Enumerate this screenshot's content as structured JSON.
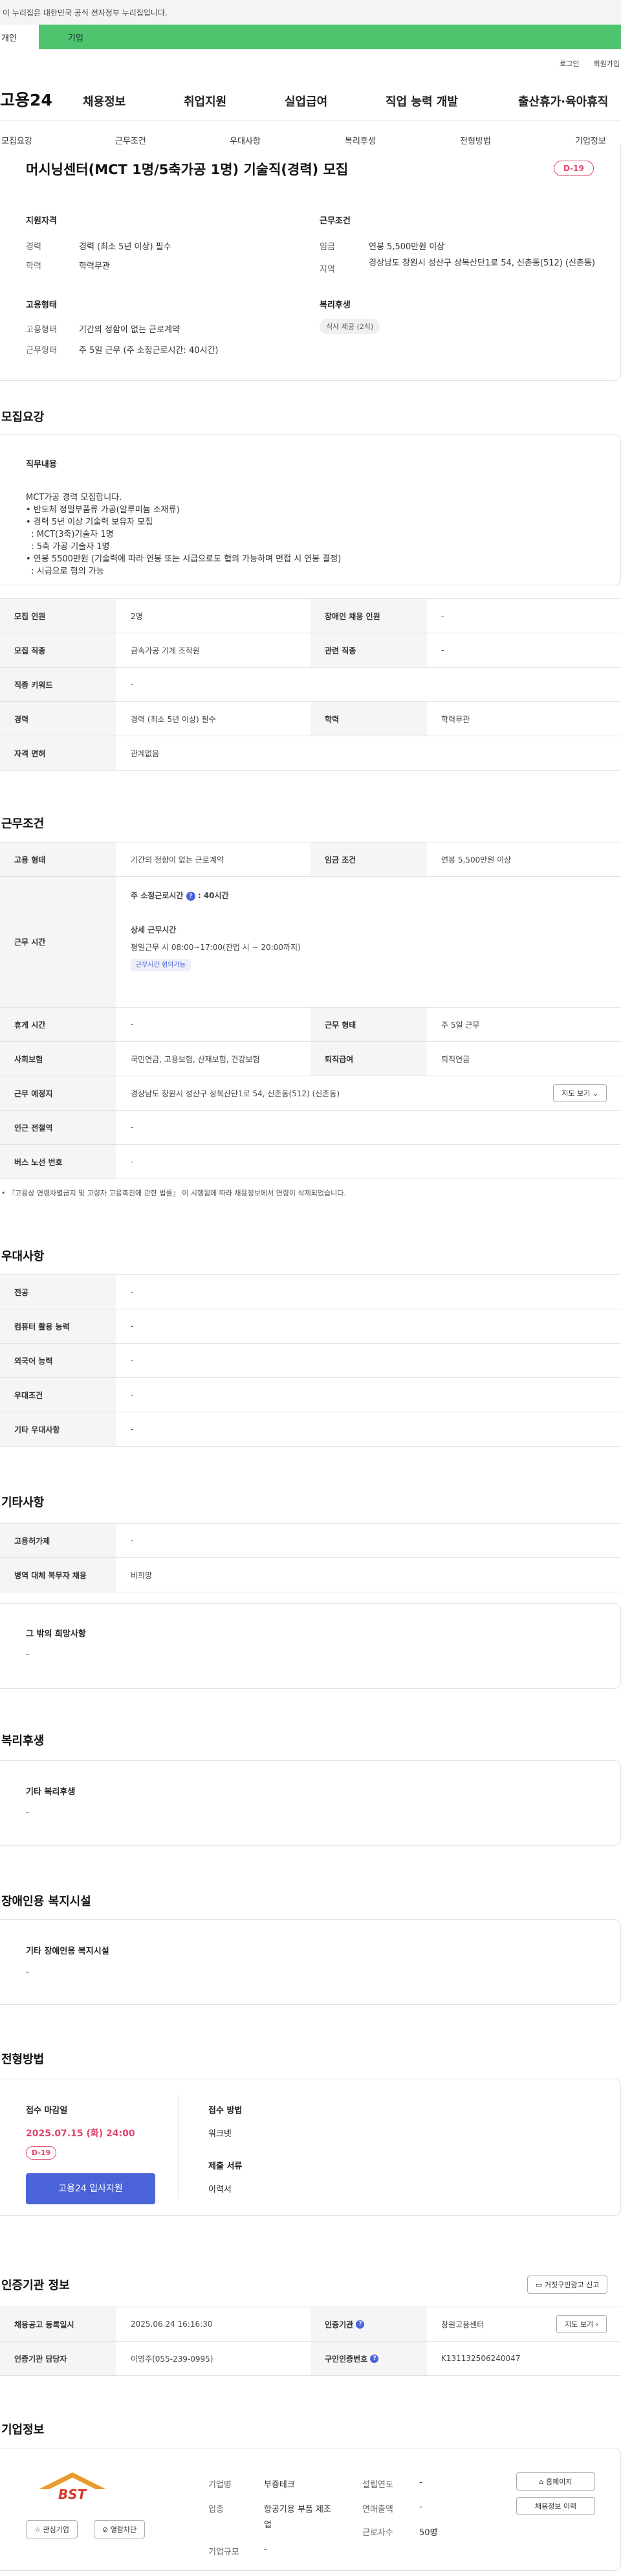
{
  "gov_banner": "이 누리집은 대한민국 공식 전자정부 누리집입니다.",
  "top_tabs": {
    "personal": "개인",
    "corp": "기업"
  },
  "util": {
    "login": "로그인",
    "signup": "회원가입"
  },
  "logo": "고용24",
  "gnb": [
    "채용정보",
    "취업지원",
    "실업급여",
    "직업 능력 개발",
    "출산휴가·육아휴직"
  ],
  "subnav": [
    "모집요강",
    "근무조건",
    "우대사항",
    "복리후생",
    "전형방법",
    "기업정보"
  ],
  "job": {
    "title": "머시닝센터(MCT 1명/5축가공 1명) 기술직(경력) 모집",
    "dday": "D-19",
    "qual_head": "지원자격",
    "career_lbl": "경력",
    "career_val": "경력 (최소 5년 이상) 필수",
    "edu_lbl": "학력",
    "edu_val": "학력무관",
    "emp_head": "고용형태",
    "emptype_lbl": "고용형태",
    "emptype_val": "기간의 정함이 없는 근로계약",
    "worktype_lbl": "근무형태",
    "worktype_val": "주 5일 근무 (주 소정근로시간: 40시간)",
    "cond_head": "근무조건",
    "wage_lbl": "임금",
    "wage_val": "연봉 5,500만원 이상",
    "area_lbl": "지역",
    "area_val": "경상남도 창원시 성산구 상복산단1로 54, 신촌동(512) (신촌동)",
    "welfare_head": "복리후생",
    "welfare_chip": "식사 제공 (2식)"
  },
  "recruit": {
    "section": "모집요강",
    "duty_head": "직무내용",
    "duty_lines": [
      "MCT가공 경력 모집합니다.",
      "• 반도체 정밀부품류 가공(알루미늄 소재류)",
      "• 경력 5년 이상 기술력 보유자 모집",
      "  : MCT(3축)기술자 1명",
      "  : 5축 가공 기술자 1명",
      "• 연봉 5500만원 (기술력에 따라 연봉 또는 시급으로도 협의 가능하며 면접 시 연봉 결정)",
      "  : 시급으로 협의 가능"
    ],
    "rows": [
      {
        "l1": "모집 인원",
        "v1": "2명",
        "l2": "장애인 채용 인원",
        "v2": "-"
      },
      {
        "l1": "모집 직종",
        "v1": "금속가공 기계 조작원",
        "l2": "관련 직종",
        "v2": "-"
      },
      {
        "l1": "직종 키워드",
        "v1": "-"
      },
      {
        "l1": "경력",
        "v1": "경력 (최소 5년 이상) 필수",
        "l2": "학력",
        "v2": "학력무관"
      },
      {
        "l1": "자격 면허",
        "v1": "관계없음"
      }
    ]
  },
  "work": {
    "section": "근무조건",
    "emp_lbl": "고용 형태",
    "emp_val": "기간의 정함이 없는 근로계약",
    "wage_lbl": "임금 조건",
    "wage_val": "연봉 5,500만원 이상",
    "time_lbl": "근무 시간",
    "hours_head": "주 소정근로시간",
    "hours_val": ": 40시간",
    "detail_head": "상세 근무시간",
    "detail_val": "평일근무 시 08:00~17:00(잔업 시 ~ 20:00까지)",
    "flex_chip": "근무시간 협의가능",
    "holiday_lbl": "휴게 시간",
    "holiday_val": "-",
    "form_lbl": "근무 형태",
    "form_val": "주 5일 근무",
    "ins_lbl": "사회보험",
    "ins_val": "국민연금, 고용보험, 산재보험, 건강보험",
    "ret_lbl": "퇴직급여",
    "ret_val": "퇴직연금",
    "place_lbl": "근무 예정지",
    "place_val": "경상남도 창원시 성산구 상복산단1로 54, 신촌동(512) (신촌동)",
    "map_btn": "지도 보기",
    "station_lbl": "인근 전철역",
    "station_val": "-",
    "bus_lbl": "버스 노선 번호",
    "bus_val": "-",
    "notice": "• 『고용상 연령차별금지 및 고령자 고용촉진에 관한 법률』 이 시행됨에 따라 채용정보에서 연령이 삭제되었습니다."
  },
  "pref": {
    "section": "우대사항",
    "rows": [
      {
        "l": "전공",
        "v": "-"
      },
      {
        "l": "컴퓨터 활용 능력",
        "v": "-"
      },
      {
        "l": "외국어 능력",
        "v": "-"
      },
      {
        "l": "우대조건",
        "v": "-"
      },
      {
        "l": "기타 우대사항",
        "v": "-"
      }
    ]
  },
  "etc": {
    "section": "기타사항",
    "rows": [
      {
        "l": "고용허가제",
        "v": "-"
      },
      {
        "l": "병역 대체 복무자 채용",
        "v": "비희망"
      }
    ],
    "wish_head": "그 밖의 희망사항",
    "wish_val": "-"
  },
  "welfare": {
    "section": "복리후생",
    "head": "기타 복리후생",
    "val": "-"
  },
  "disabled": {
    "section": "장애인용 복지시설",
    "head": "기타 장애인용 복지시설",
    "val": "-"
  },
  "process": {
    "section": "전형방법",
    "deadline_head": "접수 마감일",
    "deadline_val": "2025.07.15 (화) 24:00",
    "dday": "D-19",
    "apply_btn": "고용24 입사지원",
    "method_head": "접수 방법",
    "method_val": "워크넷",
    "docs_head": "제출 서류",
    "docs_val": "이력서"
  },
  "cert": {
    "section": "인증기관 정보",
    "report_btn": "거짓구인광고 신고",
    "reg_lbl": "채용공고 등록일시",
    "reg_val": "2025.06.24 16:16:30",
    "org_lbl": "인증기관",
    "org_val": "창원고용센터",
    "map_btn": "지도 보기",
    "mgr_lbl": "인증기관 담당자",
    "mgr_val": "이영주(055-239-0995)",
    "num_lbl": "구인인증번호",
    "num_val": "K131132506240047"
  },
  "company": {
    "section": "기업정보",
    "logo_text": "BST",
    "fav_btn": "관심기업",
    "block_btn": "열람차단",
    "name_lbl": "기업명",
    "name_val": "부증테크",
    "ind_lbl": "업종",
    "ind_val": "항공기용 부품 제조업",
    "size_lbl": "기업규모",
    "size_val": "-",
    "est_lbl": "설립연도",
    "est_val": "-",
    "sales_lbl": "연매출액",
    "sales_val": "-",
    "emp_lbl": "근로자수",
    "emp_val": "50명",
    "home_btn": "홈페이지",
    "history_btn": "채용정보 이력"
  },
  "colors": {
    "accent_green": "#4fc46f",
    "dday_red": "#e0446b",
    "apply_blue": "#4a63d8"
  }
}
